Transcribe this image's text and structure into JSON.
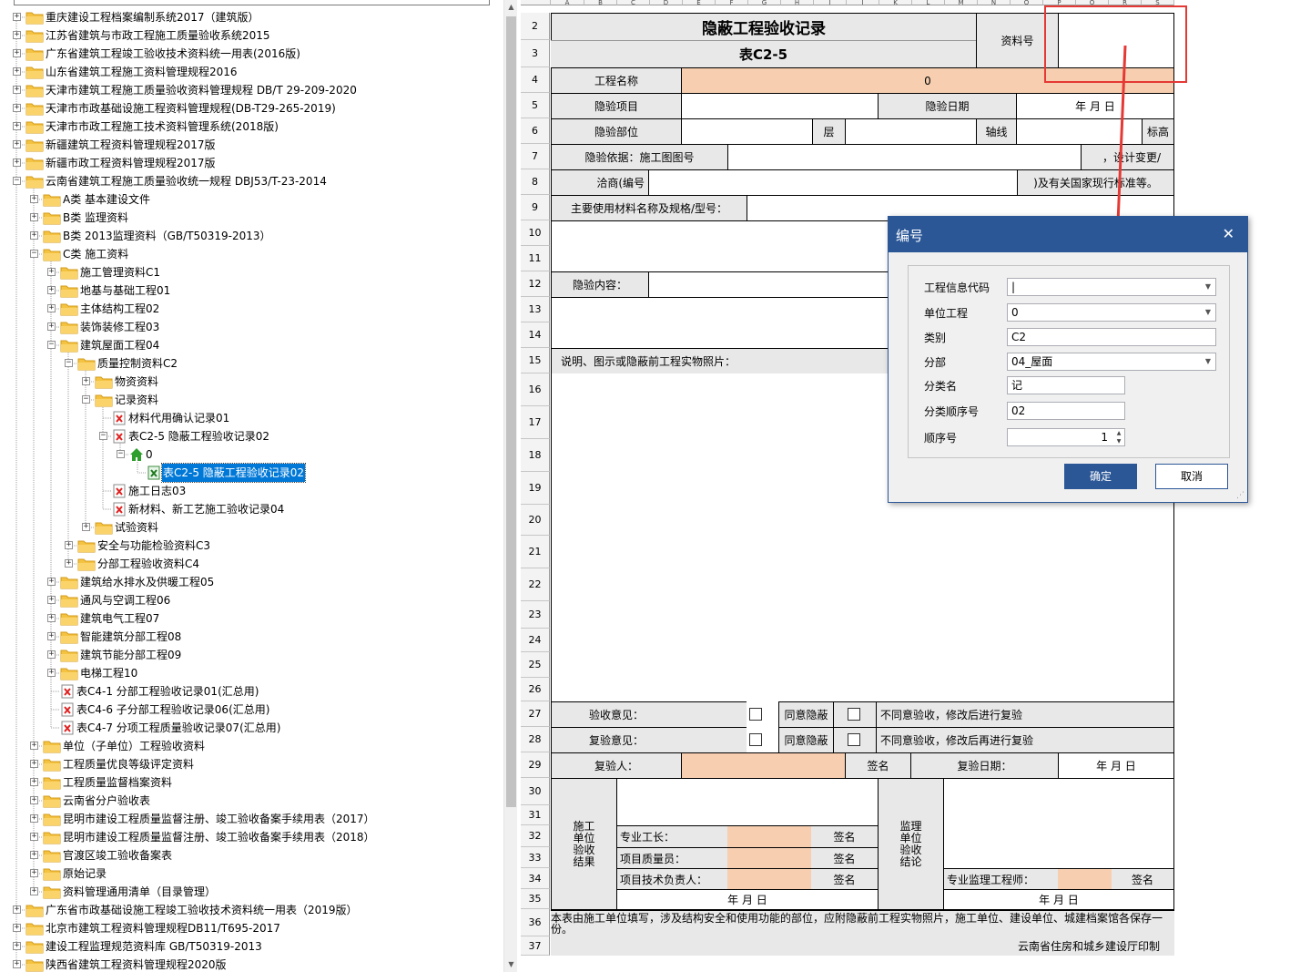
{
  "tree": {
    "items": [
      {
        "label": "重庆建设工程档案编制系统2017（建筑版）",
        "icon": "folder-icon",
        "expanded": false
      },
      {
        "label": "江苏省建筑与市政工程施工质量验收系统2015",
        "icon": "folder-icon",
        "expanded": false
      },
      {
        "label": "广东省建筑工程竣工验收技术资料统一用表(2016版)",
        "icon": "folder-icon",
        "expanded": false
      },
      {
        "label": "山东省建筑工程施工资料管理规程2016",
        "icon": "folder-icon",
        "expanded": false
      },
      {
        "label": "天津市建筑工程施工质量验收资料管理规程 DB/T 29-209-2020",
        "icon": "folder-icon",
        "expanded": false
      },
      {
        "label": "天津市市政基础设施工程资料管理规程(DB-T29-265-2019)",
        "icon": "folder-icon",
        "expanded": false
      },
      {
        "label": "天津市市政工程施工技术资料管理系统(2018版)",
        "icon": "folder-icon",
        "expanded": false
      },
      {
        "label": "新疆建筑工程资料管理规程2017版",
        "icon": "folder-icon",
        "expanded": false
      },
      {
        "label": "新疆市政工程资料管理规程2017版",
        "icon": "folder-icon",
        "expanded": false
      },
      {
        "label": "云南省建筑工程施工质量验收统一规程 DBJ53/T-23-2014",
        "icon": "folder-icon",
        "expanded": true
      },
      {
        "label": "A类 基本建设文件",
        "icon": "folder-icon",
        "expanded": false
      },
      {
        "label": "B类 监理资料",
        "icon": "folder-icon",
        "expanded": false
      },
      {
        "label": "B类 2013监理资料（GB/T50319-2013）",
        "icon": "folder-icon",
        "expanded": false
      },
      {
        "label": "C类 施工资料",
        "icon": "folder-icon",
        "expanded": true
      },
      {
        "label": "施工管理资料C1",
        "icon": "folder-icon",
        "expanded": false
      },
      {
        "label": "地基与基础工程01",
        "icon": "folder-icon",
        "expanded": false
      },
      {
        "label": "主体结构工程02",
        "icon": "folder-icon",
        "expanded": false
      },
      {
        "label": "装饰装修工程03",
        "icon": "folder-icon",
        "expanded": false
      },
      {
        "label": "建筑屋面工程04",
        "icon": "folder-icon",
        "expanded": true
      },
      {
        "label": "质量控制资料C2",
        "icon": "folder-icon",
        "expanded": true
      },
      {
        "label": "物资资料",
        "icon": "folder-icon",
        "expanded": false
      },
      {
        "label": "记录资料",
        "icon": "folder-icon",
        "expanded": true
      },
      {
        "label": "材料代用确认记录01",
        "icon": "excel-file-icon"
      },
      {
        "label": "表C2-5 隐蔽工程验收记录02",
        "icon": "excel-file-icon",
        "expanded": true
      },
      {
        "label": "0",
        "icon": "home-icon",
        "expanded": true
      },
      {
        "label": "表C2-5 隐蔽工程验收记录02",
        "icon": "excel-sheet-icon",
        "selected": true
      },
      {
        "label": "施工日志03",
        "icon": "excel-file-icon"
      },
      {
        "label": "新材料、新工艺施工验收记录04",
        "icon": "excel-file-icon"
      },
      {
        "label": "试验资料",
        "icon": "folder-icon",
        "expanded": false
      },
      {
        "label": "安全与功能检验资料C3",
        "icon": "folder-icon",
        "expanded": false
      },
      {
        "label": "分部工程验收资料C4",
        "icon": "folder-icon",
        "expanded": false
      },
      {
        "label": "建筑给水排水及供暖工程05",
        "icon": "folder-icon",
        "expanded": false
      },
      {
        "label": "通风与空调工程06",
        "icon": "folder-icon",
        "expanded": false
      },
      {
        "label": "建筑电气工程07",
        "icon": "folder-icon",
        "expanded": false
      },
      {
        "label": "智能建筑分部工程08",
        "icon": "folder-icon",
        "expanded": false
      },
      {
        "label": "建筑节能分部工程09",
        "icon": "folder-icon",
        "expanded": false
      },
      {
        "label": "电梯工程10",
        "icon": "folder-icon",
        "expanded": false
      },
      {
        "label": "表C4-1 分部工程验收记录01(汇总用)",
        "icon": "excel-file-icon"
      },
      {
        "label": "表C4-6 子分部工程验收记录06(汇总用)",
        "icon": "excel-file-icon"
      },
      {
        "label": "表C4-7 分项工程质量验收记录07(汇总用)",
        "icon": "excel-file-icon"
      },
      {
        "label": "单位（子单位）工程验收资料",
        "icon": "folder-icon",
        "expanded": false
      },
      {
        "label": "工程质量优良等级评定资料",
        "icon": "folder-icon",
        "expanded": false
      },
      {
        "label": "工程质量监督档案资料",
        "icon": "folder-icon",
        "expanded": false
      },
      {
        "label": "云南省分户验收表",
        "icon": "folder-icon",
        "expanded": false
      },
      {
        "label": "昆明市建设工程质量监督注册、竣工验收备案手续用表（2017）",
        "icon": "folder-icon",
        "expanded": false
      },
      {
        "label": "昆明市建设工程质量监督注册、竣工验收备案手续用表（2018）",
        "icon": "folder-icon",
        "expanded": false
      },
      {
        "label": "官渡区竣工验收备案表",
        "icon": "folder-icon",
        "expanded": false
      },
      {
        "label": "原始记录",
        "icon": "folder-icon",
        "expanded": false
      },
      {
        "label": "资料管理通用清单（目录管理）",
        "icon": "folder-icon",
        "expanded": false
      },
      {
        "label": "广东省市政基础设施工程竣工验收技术资料统一用表（2019版）",
        "icon": "folder-icon",
        "expanded": false
      },
      {
        "label": "北京市建筑工程资料管理规程DB11/T695-2017",
        "icon": "folder-icon",
        "expanded": false
      },
      {
        "label": "建设工程监理规范资料库 GB/T50319-2013",
        "icon": "folder-icon",
        "expanded": false
      },
      {
        "label": "陕西省建筑工程资料管理规程2020版",
        "icon": "folder-icon",
        "expanded": false
      }
    ]
  },
  "sheet": {
    "columns": [
      "A",
      "B",
      "C",
      "D",
      "E",
      "F",
      "G",
      "H",
      "I",
      "J",
      "K",
      "L",
      "M",
      "N",
      "O",
      "P",
      "Q",
      "R",
      "S"
    ],
    "rows": [
      "2",
      "3",
      "4",
      "5",
      "6",
      "7",
      "8",
      "9",
      "10",
      "11",
      "12",
      "13",
      "14",
      "15",
      "16",
      "17",
      "18",
      "19",
      "20",
      "21",
      "22",
      "23",
      "24",
      "25",
      "26",
      "27",
      "28",
      "29",
      "30",
      "31",
      "32",
      "33",
      "34",
      "35",
      "36",
      "37"
    ],
    "title": "隐蔽工程验收记录",
    "form_code": "表C2-5",
    "doc_no_label": "资料号",
    "project_name_label": "工程名称",
    "project_name_value": "0",
    "hidden_item_label": "隐验项目",
    "hidden_date_label": "隐验日期",
    "date_placeholder": "年   月   日",
    "hidden_part_label": "隐验部位",
    "floor_label": "层",
    "axis_label": "轴线",
    "elevation_label": "标高",
    "basis_label": "隐验依据：施工图图号",
    "design_change_label": "，设计变更/",
    "negotiation_label": "洽商(编号",
    "standard_label": ")及有关国家现行标准等。",
    "materials_label": "主要使用材料名称及规格/型号：",
    "content_label": "隐验内容：",
    "description_label": "说明、图示或隐蔽前工程实物照片：",
    "acceptance_opinion_label": "验收意见：",
    "agree_label": "同意隐蔽",
    "disagree_accept_label": "不同意验收，修改后进行复验",
    "reinspect_opinion_label": "复验意见：",
    "disagree_reinspect_label": "不同意验收，修改后再进行复验",
    "reinspector_label": "复验人：",
    "sign_label": "签名",
    "reinspect_date_label": "复验日期：",
    "construction_unit_label": "施工单位验收结果",
    "foreman_label": "专业工长：",
    "quality_officer_label": "项目质量员：",
    "tech_lead_label": "项目技术负责人：",
    "supervision_unit_label": "监理单位验收结论",
    "supervisor_label": "专业监理工程师：",
    "footnote": "本表由施工单位填写，涉及结构安全和使用功能的部位，应附隐蔽前工程实物照片，施工单位、建设单位、城建档案馆各保存一份。",
    "printer": "云南省住房和城乡建设厅印制"
  },
  "dialog": {
    "title": "编号",
    "close_icon": "close-icon",
    "fields": [
      {
        "label": "工程信息代码",
        "value": "|",
        "type": "dropdown"
      },
      {
        "label": "单位工程",
        "value": "0",
        "type": "dropdown"
      },
      {
        "label": "类别",
        "value": "C2",
        "type": "text"
      },
      {
        "label": "分部",
        "value": "04_屋面",
        "type": "dropdown"
      },
      {
        "label": "分类名",
        "value": "记",
        "type": "text"
      },
      {
        "label": "分类顺序号",
        "value": "02",
        "type": "text"
      },
      {
        "label": "顺序号",
        "value": "1",
        "type": "spinner"
      }
    ],
    "ok_label": "确定",
    "cancel_label": "取消"
  },
  "colors": {
    "accent": "#2b5797",
    "highlight_cell": "#f7cfb0",
    "annotation_red": "#e53935",
    "gray_cell": "#e8e8e8",
    "folder": "#f5c342"
  }
}
